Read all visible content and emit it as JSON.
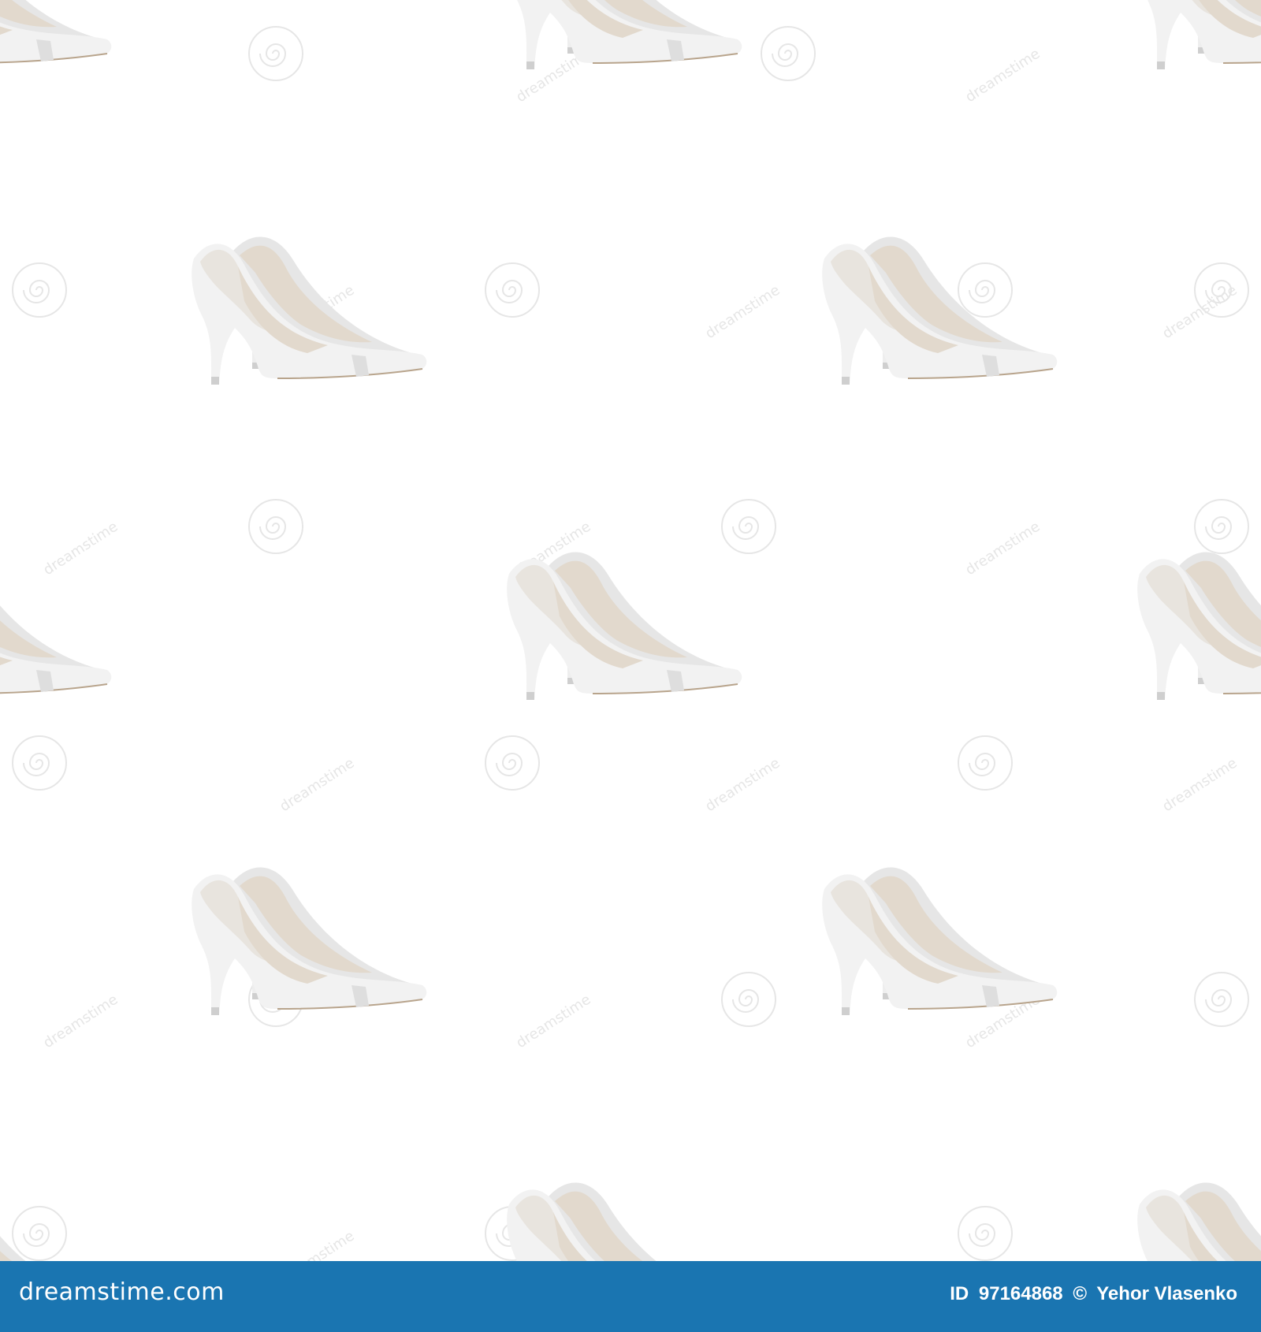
{
  "pattern": {
    "motif": "pair-of-white-high-heel-pumps",
    "background_color": "#ffffff",
    "shoe_colors": {
      "upper": "#f2f2f2",
      "rear_upper": "#e6e6e6",
      "lining": "#e2d9cd",
      "lining_shadow": "#c9bba7",
      "heel": "#eeeeee",
      "heel_tip": "#cfcfcf",
      "sole_line": "#b8a48c"
    },
    "watermark_color": "#e6e6e6",
    "watermark_text": "dreamstime"
  },
  "footer": {
    "background_color": "#1a75b1",
    "brand": "dreamstime.com",
    "id_label": "ID",
    "id_value": "97164868",
    "copyright_symbol": "©",
    "author": "Yehor Vlasenko"
  }
}
